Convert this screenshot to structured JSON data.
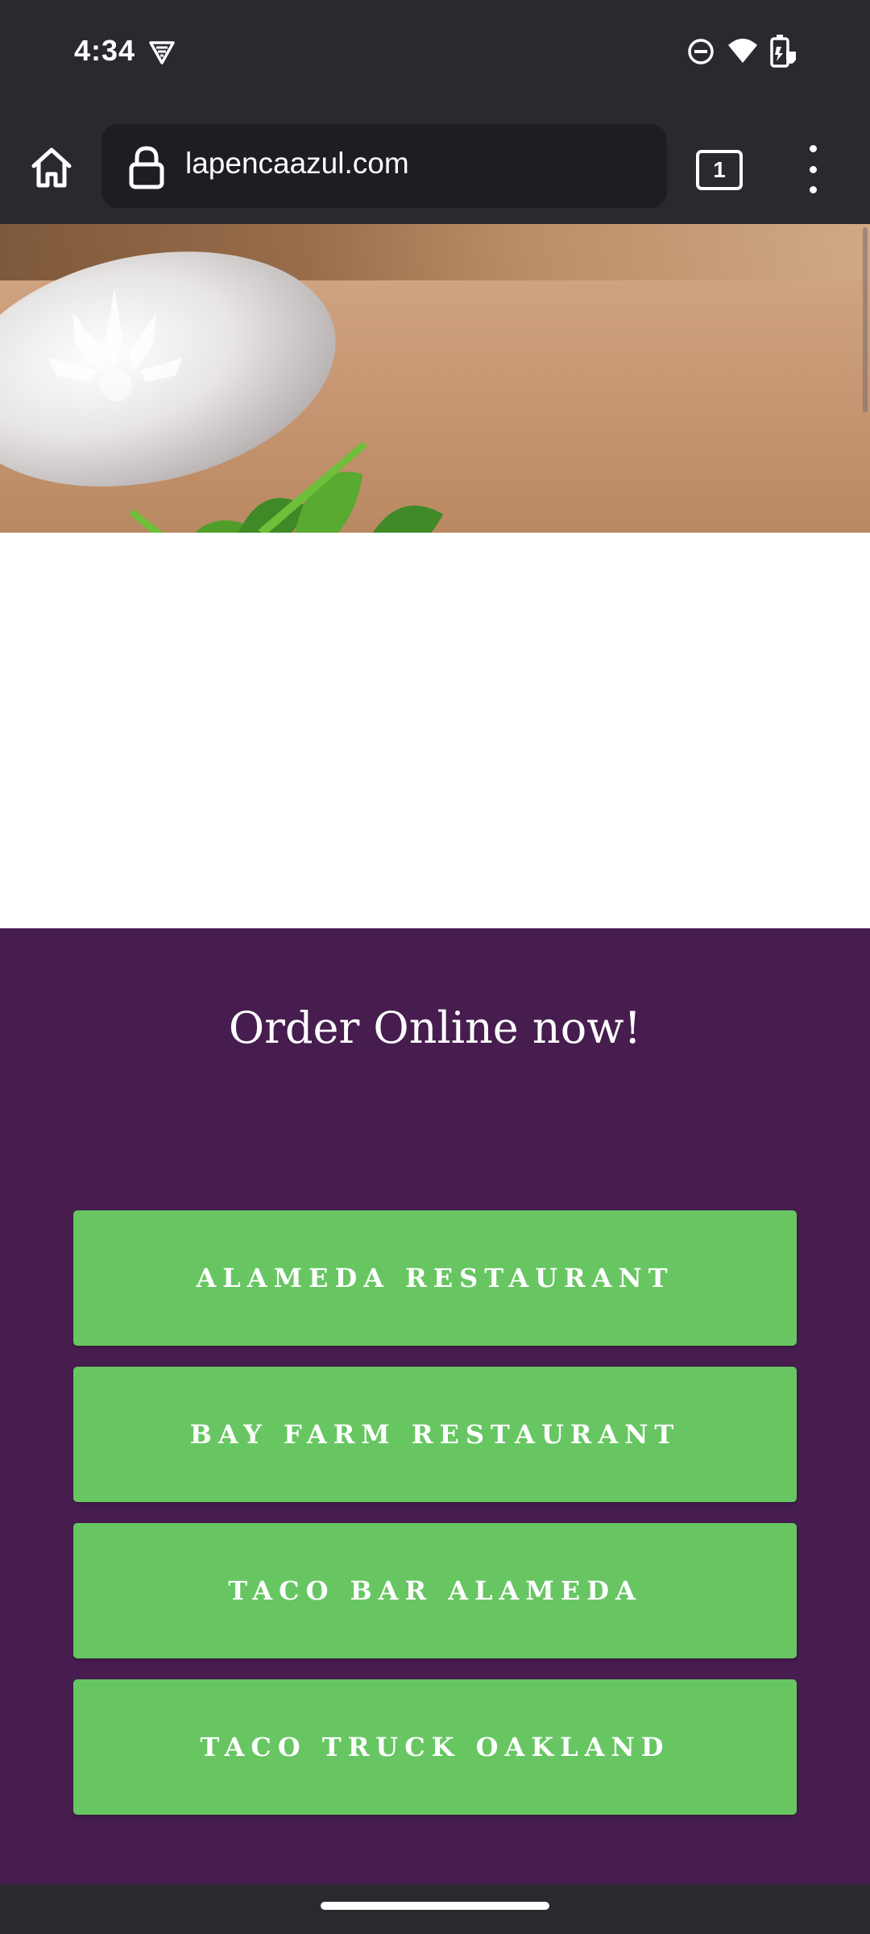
{
  "status_bar": {
    "time": "4:34",
    "icons": [
      "vpn-shield-icon",
      "do-not-disturb-icon",
      "wifi-icon",
      "battery-saver-icon"
    ]
  },
  "browser": {
    "url": "lapencaazul.com",
    "tab_count": "1",
    "icons": [
      "home-icon",
      "lock-icon",
      "tab-switcher-icon",
      "overflow-menu-icon"
    ]
  },
  "page": {
    "order_heading": "Order Online now!",
    "locations": [
      {
        "label": "ALAMEDA RESTAURANT"
      },
      {
        "label": "BAY FARM RESTAURANT"
      },
      {
        "label": "TACO BAR ALAMEDA"
      },
      {
        "label": "TACO TRUCK OAKLAND"
      }
    ]
  },
  "colors": {
    "system_bars": "#2b2930",
    "url_field": "#1f1d23",
    "section_background": "#461d4e",
    "button_green": "#67c662",
    "text_white": "#ffffff"
  }
}
